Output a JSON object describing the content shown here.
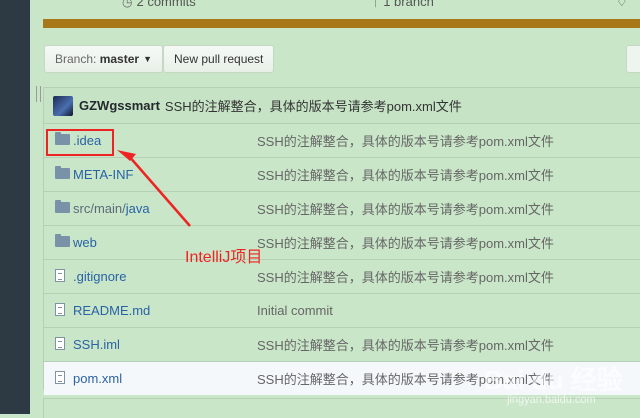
{
  "stats": {
    "commits": "2 commits",
    "branch": "1 branch"
  },
  "branch_button": {
    "prefix": "Branch:",
    "name": "master"
  },
  "pull_request_button": "New pull request",
  "latest_commit": {
    "author": "GZWgssmart",
    "message": "SSH的注解整合，具体的版本号请参考pom.xml文件"
  },
  "files": [
    {
      "type": "folder",
      "name": ".idea",
      "dir": "",
      "message": "SSH的注解整合，具体的版本号请参考pom.xml文件"
    },
    {
      "type": "folder",
      "name": "META-INF",
      "dir": "",
      "message": "SSH的注解整合，具体的版本号请参考pom.xml文件"
    },
    {
      "type": "folder",
      "name": "java",
      "dir": "src/main/",
      "message": "SSH的注解整合，具体的版本号请参考pom.xml文件"
    },
    {
      "type": "folder",
      "name": "web",
      "dir": "",
      "message": "SSH的注解整合，具体的版本号请参考pom.xml文件"
    },
    {
      "type": "file",
      "name": ".gitignore",
      "dir": "",
      "message": "SSH的注解整合，具体的版本号请参考pom.xml文件"
    },
    {
      "type": "file",
      "name": "README.md",
      "dir": "",
      "message": "Initial commit"
    },
    {
      "type": "file",
      "name": "SSH.iml",
      "dir": "",
      "message": "SSH的注解整合，具体的版本号请参考pom.xml文件"
    },
    {
      "type": "file",
      "name": "pom.xml",
      "dir": "",
      "message": "SSH的注解整合，具体的版本号请参考pom.xml文件"
    }
  ],
  "annotation": "IntelliJ项目",
  "watermark": {
    "text": "Bai du 经验",
    "url": "jingyan.baidu.com"
  },
  "colors": {
    "background": "#c9e6c8",
    "accent_bar": "#a87718",
    "link": "#2a62a6",
    "annotation_red": "#ee2424",
    "left_rail": "#2d3a44"
  }
}
